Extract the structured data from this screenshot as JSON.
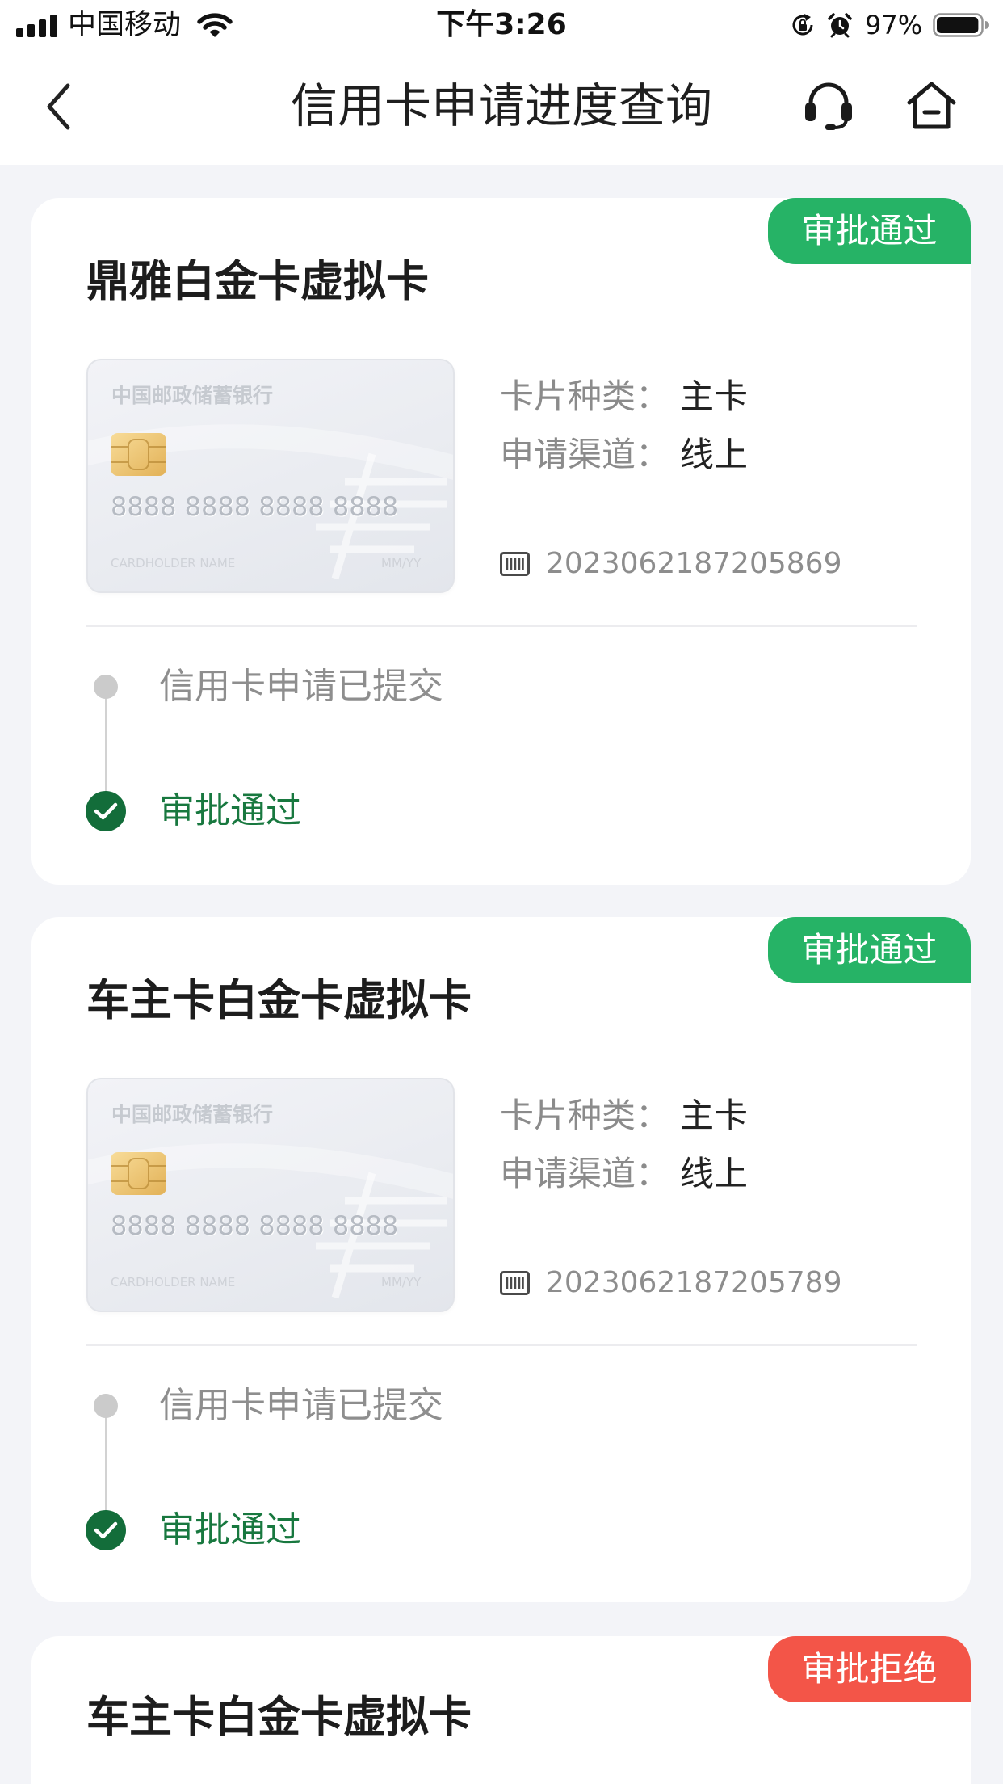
{
  "status_bar": {
    "carrier": "中国移动",
    "time": "下午3:26",
    "battery_text": "97%",
    "battery_level": 0.97,
    "icons": [
      "signal-icon",
      "wifi-icon",
      "orientation-lock-icon",
      "alarm-icon",
      "battery-icon"
    ]
  },
  "nav": {
    "title": "信用卡申请进度查询",
    "icons": {
      "back": "chevron-left-icon",
      "service": "headset-icon",
      "home": "home-icon"
    }
  },
  "colors": {
    "page_background": "#f3f4f8",
    "progress_text": "#18783f",
    "check_icon": "#136d3a"
  },
  "applications": [
    {
      "status": "审批通过",
      "status_color": "#26b366",
      "card_name": "鼎雅白金卡虚拟卡",
      "card_face": {
        "bank": "中国邮政储蓄银行",
        "number": "8888 8888 8888 8888",
        "holder": "CARDHOLDER NAME",
        "expiry": "MM/YY"
      },
      "card_type_label": "卡片种类：",
      "card_type_value": "主卡",
      "channel_label": "申请渠道：",
      "channel_value": "线上",
      "application_icon": "barcode-icon",
      "application_no": "2023062187205869",
      "timeline": [
        {
          "text": "信用卡申请已提交",
          "icon": "grey-dot-icon"
        },
        {
          "text": "审批通过",
          "icon": "check-circle-icon"
        }
      ]
    },
    {
      "status": "审批通过",
      "status_color": "#26b366",
      "card_name": "车主卡白金卡虚拟卡",
      "card_face": {
        "bank": "中国邮政储蓄银行",
        "number": "8888 8888 8888 8888",
        "holder": "CARDHOLDER NAME",
        "expiry": "MM/YY"
      },
      "card_type_label": "卡片种类：",
      "card_type_value": "主卡",
      "channel_label": "申请渠道：",
      "channel_value": "线上",
      "application_icon": "barcode-icon",
      "application_no": "2023062187205789",
      "timeline": [
        {
          "text": "信用卡申请已提交",
          "icon": "grey-dot-icon"
        },
        {
          "text": "审批通过",
          "icon": "check-circle-icon"
        }
      ]
    },
    {
      "status": "审批拒绝",
      "status_color": "#f35548",
      "card_name": "车主卡白金卡虚拟卡"
    }
  ]
}
